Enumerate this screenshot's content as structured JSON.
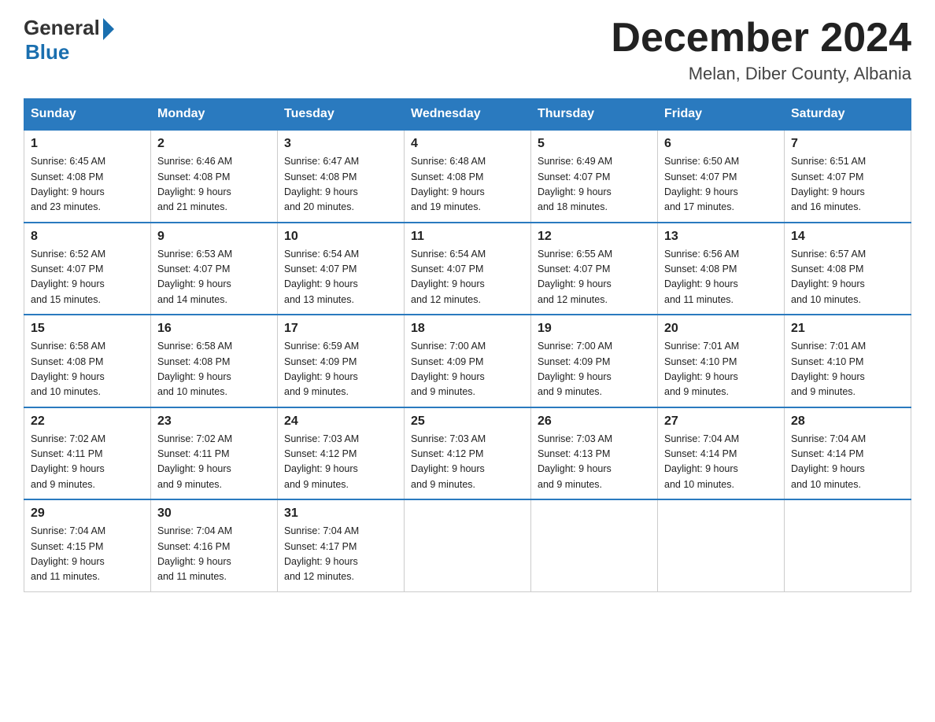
{
  "header": {
    "logo_general": "General",
    "logo_blue": "Blue",
    "title": "December 2024",
    "subtitle": "Melan, Diber County, Albania"
  },
  "columns": [
    "Sunday",
    "Monday",
    "Tuesday",
    "Wednesday",
    "Thursday",
    "Friday",
    "Saturday"
  ],
  "weeks": [
    [
      {
        "day": "1",
        "sunrise": "Sunrise: 6:45 AM",
        "sunset": "Sunset: 4:08 PM",
        "daylight": "Daylight: 9 hours",
        "daylight2": "and 23 minutes."
      },
      {
        "day": "2",
        "sunrise": "Sunrise: 6:46 AM",
        "sunset": "Sunset: 4:08 PM",
        "daylight": "Daylight: 9 hours",
        "daylight2": "and 21 minutes."
      },
      {
        "day": "3",
        "sunrise": "Sunrise: 6:47 AM",
        "sunset": "Sunset: 4:08 PM",
        "daylight": "Daylight: 9 hours",
        "daylight2": "and 20 minutes."
      },
      {
        "day": "4",
        "sunrise": "Sunrise: 6:48 AM",
        "sunset": "Sunset: 4:08 PM",
        "daylight": "Daylight: 9 hours",
        "daylight2": "and 19 minutes."
      },
      {
        "day": "5",
        "sunrise": "Sunrise: 6:49 AM",
        "sunset": "Sunset: 4:07 PM",
        "daylight": "Daylight: 9 hours",
        "daylight2": "and 18 minutes."
      },
      {
        "day": "6",
        "sunrise": "Sunrise: 6:50 AM",
        "sunset": "Sunset: 4:07 PM",
        "daylight": "Daylight: 9 hours",
        "daylight2": "and 17 minutes."
      },
      {
        "day": "7",
        "sunrise": "Sunrise: 6:51 AM",
        "sunset": "Sunset: 4:07 PM",
        "daylight": "Daylight: 9 hours",
        "daylight2": "and 16 minutes."
      }
    ],
    [
      {
        "day": "8",
        "sunrise": "Sunrise: 6:52 AM",
        "sunset": "Sunset: 4:07 PM",
        "daylight": "Daylight: 9 hours",
        "daylight2": "and 15 minutes."
      },
      {
        "day": "9",
        "sunrise": "Sunrise: 6:53 AM",
        "sunset": "Sunset: 4:07 PM",
        "daylight": "Daylight: 9 hours",
        "daylight2": "and 14 minutes."
      },
      {
        "day": "10",
        "sunrise": "Sunrise: 6:54 AM",
        "sunset": "Sunset: 4:07 PM",
        "daylight": "Daylight: 9 hours",
        "daylight2": "and 13 minutes."
      },
      {
        "day": "11",
        "sunrise": "Sunrise: 6:54 AM",
        "sunset": "Sunset: 4:07 PM",
        "daylight": "Daylight: 9 hours",
        "daylight2": "and 12 minutes."
      },
      {
        "day": "12",
        "sunrise": "Sunrise: 6:55 AM",
        "sunset": "Sunset: 4:07 PM",
        "daylight": "Daylight: 9 hours",
        "daylight2": "and 12 minutes."
      },
      {
        "day": "13",
        "sunrise": "Sunrise: 6:56 AM",
        "sunset": "Sunset: 4:08 PM",
        "daylight": "Daylight: 9 hours",
        "daylight2": "and 11 minutes."
      },
      {
        "day": "14",
        "sunrise": "Sunrise: 6:57 AM",
        "sunset": "Sunset: 4:08 PM",
        "daylight": "Daylight: 9 hours",
        "daylight2": "and 10 minutes."
      }
    ],
    [
      {
        "day": "15",
        "sunrise": "Sunrise: 6:58 AM",
        "sunset": "Sunset: 4:08 PM",
        "daylight": "Daylight: 9 hours",
        "daylight2": "and 10 minutes."
      },
      {
        "day": "16",
        "sunrise": "Sunrise: 6:58 AM",
        "sunset": "Sunset: 4:08 PM",
        "daylight": "Daylight: 9 hours",
        "daylight2": "and 10 minutes."
      },
      {
        "day": "17",
        "sunrise": "Sunrise: 6:59 AM",
        "sunset": "Sunset: 4:09 PM",
        "daylight": "Daylight: 9 hours",
        "daylight2": "and 9 minutes."
      },
      {
        "day": "18",
        "sunrise": "Sunrise: 7:00 AM",
        "sunset": "Sunset: 4:09 PM",
        "daylight": "Daylight: 9 hours",
        "daylight2": "and 9 minutes."
      },
      {
        "day": "19",
        "sunrise": "Sunrise: 7:00 AM",
        "sunset": "Sunset: 4:09 PM",
        "daylight": "Daylight: 9 hours",
        "daylight2": "and 9 minutes."
      },
      {
        "day": "20",
        "sunrise": "Sunrise: 7:01 AM",
        "sunset": "Sunset: 4:10 PM",
        "daylight": "Daylight: 9 hours",
        "daylight2": "and 9 minutes."
      },
      {
        "day": "21",
        "sunrise": "Sunrise: 7:01 AM",
        "sunset": "Sunset: 4:10 PM",
        "daylight": "Daylight: 9 hours",
        "daylight2": "and 9 minutes."
      }
    ],
    [
      {
        "day": "22",
        "sunrise": "Sunrise: 7:02 AM",
        "sunset": "Sunset: 4:11 PM",
        "daylight": "Daylight: 9 hours",
        "daylight2": "and 9 minutes."
      },
      {
        "day": "23",
        "sunrise": "Sunrise: 7:02 AM",
        "sunset": "Sunset: 4:11 PM",
        "daylight": "Daylight: 9 hours",
        "daylight2": "and 9 minutes."
      },
      {
        "day": "24",
        "sunrise": "Sunrise: 7:03 AM",
        "sunset": "Sunset: 4:12 PM",
        "daylight": "Daylight: 9 hours",
        "daylight2": "and 9 minutes."
      },
      {
        "day": "25",
        "sunrise": "Sunrise: 7:03 AM",
        "sunset": "Sunset: 4:12 PM",
        "daylight": "Daylight: 9 hours",
        "daylight2": "and 9 minutes."
      },
      {
        "day": "26",
        "sunrise": "Sunrise: 7:03 AM",
        "sunset": "Sunset: 4:13 PM",
        "daylight": "Daylight: 9 hours",
        "daylight2": "and 9 minutes."
      },
      {
        "day": "27",
        "sunrise": "Sunrise: 7:04 AM",
        "sunset": "Sunset: 4:14 PM",
        "daylight": "Daylight: 9 hours",
        "daylight2": "and 10 minutes."
      },
      {
        "day": "28",
        "sunrise": "Sunrise: 7:04 AM",
        "sunset": "Sunset: 4:14 PM",
        "daylight": "Daylight: 9 hours",
        "daylight2": "and 10 minutes."
      }
    ],
    [
      {
        "day": "29",
        "sunrise": "Sunrise: 7:04 AM",
        "sunset": "Sunset: 4:15 PM",
        "daylight": "Daylight: 9 hours",
        "daylight2": "and 11 minutes."
      },
      {
        "day": "30",
        "sunrise": "Sunrise: 7:04 AM",
        "sunset": "Sunset: 4:16 PM",
        "daylight": "Daylight: 9 hours",
        "daylight2": "and 11 minutes."
      },
      {
        "day": "31",
        "sunrise": "Sunrise: 7:04 AM",
        "sunset": "Sunset: 4:17 PM",
        "daylight": "Daylight: 9 hours",
        "daylight2": "and 12 minutes."
      },
      {
        "day": "",
        "sunrise": "",
        "sunset": "",
        "daylight": "",
        "daylight2": ""
      },
      {
        "day": "",
        "sunrise": "",
        "sunset": "",
        "daylight": "",
        "daylight2": ""
      },
      {
        "day": "",
        "sunrise": "",
        "sunset": "",
        "daylight": "",
        "daylight2": ""
      },
      {
        "day": "",
        "sunrise": "",
        "sunset": "",
        "daylight": "",
        "daylight2": ""
      }
    ]
  ]
}
